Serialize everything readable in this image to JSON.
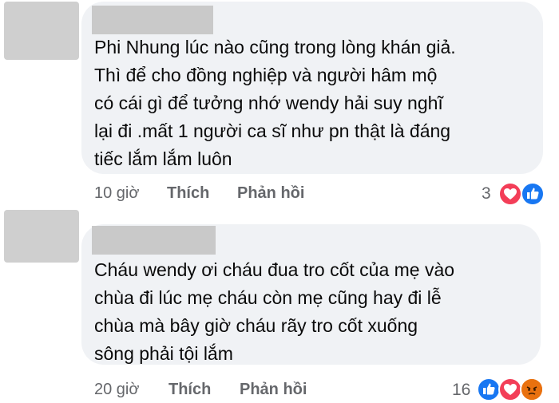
{
  "comments": [
    {
      "text": "Phi Nhung lúc nào cũng trong lòng khán giả.\nThì để cho đồng nghiệp và người hâm mộ\ncó cái gì để tưởng nhớ wendy hải suy nghĩ\nlại đi .mất 1 người ca sĩ như pn thật là đáng\ntiếc lắm lắm luôn",
      "time": "10 giờ",
      "like_label": "Thích",
      "reply_label": "Phản hồi",
      "reaction_count": "3",
      "reactions": [
        "heart-icon",
        "like-icon"
      ]
    },
    {
      "text": "Cháu wendy ơi cháu đua tro cốt của mẹ vào\nchùa đi lúc mẹ cháu còn mẹ cũng hay đi lễ\nchùa mà bây giờ cháu rãy tro cốt xuống\nsông phải tội lắm",
      "time": "20 giờ",
      "like_label": "Thích",
      "reply_label": "Phản hồi",
      "reaction_count": "16",
      "reactions": [
        "like-icon",
        "heart-icon",
        "angry-icon"
      ]
    }
  ],
  "colors": {
    "bubble": "#f0f2f5",
    "like_blue": "#1877f2",
    "heart_red": "#f33e58",
    "angry_orange": "#e9710f",
    "meta_gray": "#65676b"
  }
}
